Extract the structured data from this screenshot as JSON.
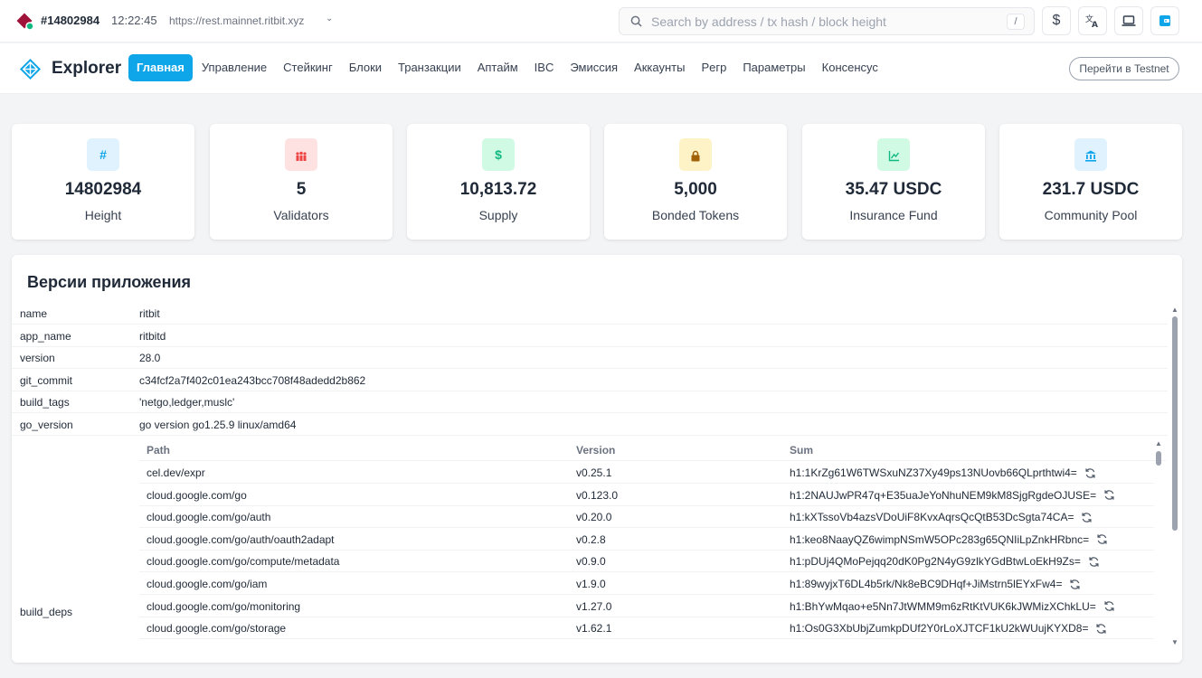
{
  "topbar": {
    "block_number": "#14802984",
    "time": "12:22:45",
    "rpc_url": "https://rest.mainnet.ritbit.xyz",
    "search_placeholder": "Search by address / tx hash / block height",
    "search_shortcut": "/",
    "currency_icon": "$",
    "translate_icon": "translate-icon",
    "device_icon": "laptop-icon",
    "wallet_icon": "wallet-icon"
  },
  "nav": {
    "brand": "Explorer",
    "items": [
      "Главная",
      "Управление",
      "Стейкинг",
      "Блоки",
      "Транзакции",
      "Аптайм",
      "IBC",
      "Эмиссия",
      "Аккаунты",
      "Pегр",
      "Параметры",
      "Консенсус"
    ],
    "active_index": 0,
    "testnet_button": "Перейти в Testnet"
  },
  "stats": [
    {
      "icon": "#",
      "value": "14802984",
      "label": "Height",
      "bg": "#e0f2fe",
      "fg": "#0ea5e9"
    },
    {
      "icon": "validators-icon",
      "value": "5",
      "label": "Validators",
      "bg": "#fee2e2",
      "fg": "#ef4444"
    },
    {
      "icon": "$",
      "value": "10,813.72",
      "label": "Supply",
      "bg": "#d1fae5",
      "fg": "#10b981"
    },
    {
      "icon": "lock-icon",
      "value": "5,000",
      "label": "Bonded Tokens",
      "bg": "#fef3c7",
      "fg": "#a16207"
    },
    {
      "icon": "chart-icon",
      "value": "35.47 USDC",
      "label": "Insurance Fund",
      "bg": "#d1fae5",
      "fg": "#10b981"
    },
    {
      "icon": "bank-icon",
      "value": "231.7 USDC",
      "label": "Community Pool",
      "bg": "#e0f2fe",
      "fg": "#0ea5e9"
    }
  ],
  "versions": {
    "title": "Версии приложения",
    "rows": [
      {
        "key": "name",
        "value": "ritbit"
      },
      {
        "key": "app_name",
        "value": "ritbitd"
      },
      {
        "key": "version",
        "value": "28.0"
      },
      {
        "key": "git_commit",
        "value": "c34fcf2a7f402c01ea243bcc708f48adedd2b862"
      },
      {
        "key": "build_tags",
        "value": "'netgo,ledger,muslc'"
      },
      {
        "key": "go_version",
        "value": "go version go1.25.9 linux/amd64"
      }
    ],
    "deps_key": "build_deps",
    "deps_headers": {
      "path": "Path",
      "version": "Version",
      "sum": "Sum"
    },
    "deps": [
      {
        "path": "cel.dev/expr",
        "version": "v0.25.1",
        "sum": "h1:1KrZg61W6TWSxuNZ37Xy49ps13NUovb66QLprthtwi4="
      },
      {
        "path": "cloud.google.com/go",
        "version": "v0.123.0",
        "sum": "h1:2NAUJwPR47q+E35uaJeYoNhuNEM9kM8SjgRgdeOJUSE="
      },
      {
        "path": "cloud.google.com/go/auth",
        "version": "v0.20.0",
        "sum": "h1:kXTssoVb4azsVDoUiF8KvxAqrsQcQtB53DcSgta74CA="
      },
      {
        "path": "cloud.google.com/go/auth/oauth2adapt",
        "version": "v0.2.8",
        "sum": "h1:keo8NaayQZ6wimpNSmW5OPc283g65QNIiLpZnkHRbnc="
      },
      {
        "path": "cloud.google.com/go/compute/metadata",
        "version": "v0.9.0",
        "sum": "h1:pDUj4QMoPejqq20dK0Pg2N4yG9zlkYGdBtwLoEkH9Zs="
      },
      {
        "path": "cloud.google.com/go/iam",
        "version": "v1.9.0",
        "sum": "h1:89wyjxT6DL4b5rk/Nk8eBC9DHqf+JiMstrn5lEYxFw4="
      },
      {
        "path": "cloud.google.com/go/monitoring",
        "version": "v1.27.0",
        "sum": "h1:BhYwMqao+e5Nn7JtWMM9m6zRtKtVUK6kJWMizXChkLU="
      },
      {
        "path": "cloud.google.com/go/storage",
        "version": "v1.62.1",
        "sum": "h1:Os0G3XbUbjZumkpDUf2Y0rLoXJTCF1kU2kWUujKYXD8="
      }
    ]
  }
}
